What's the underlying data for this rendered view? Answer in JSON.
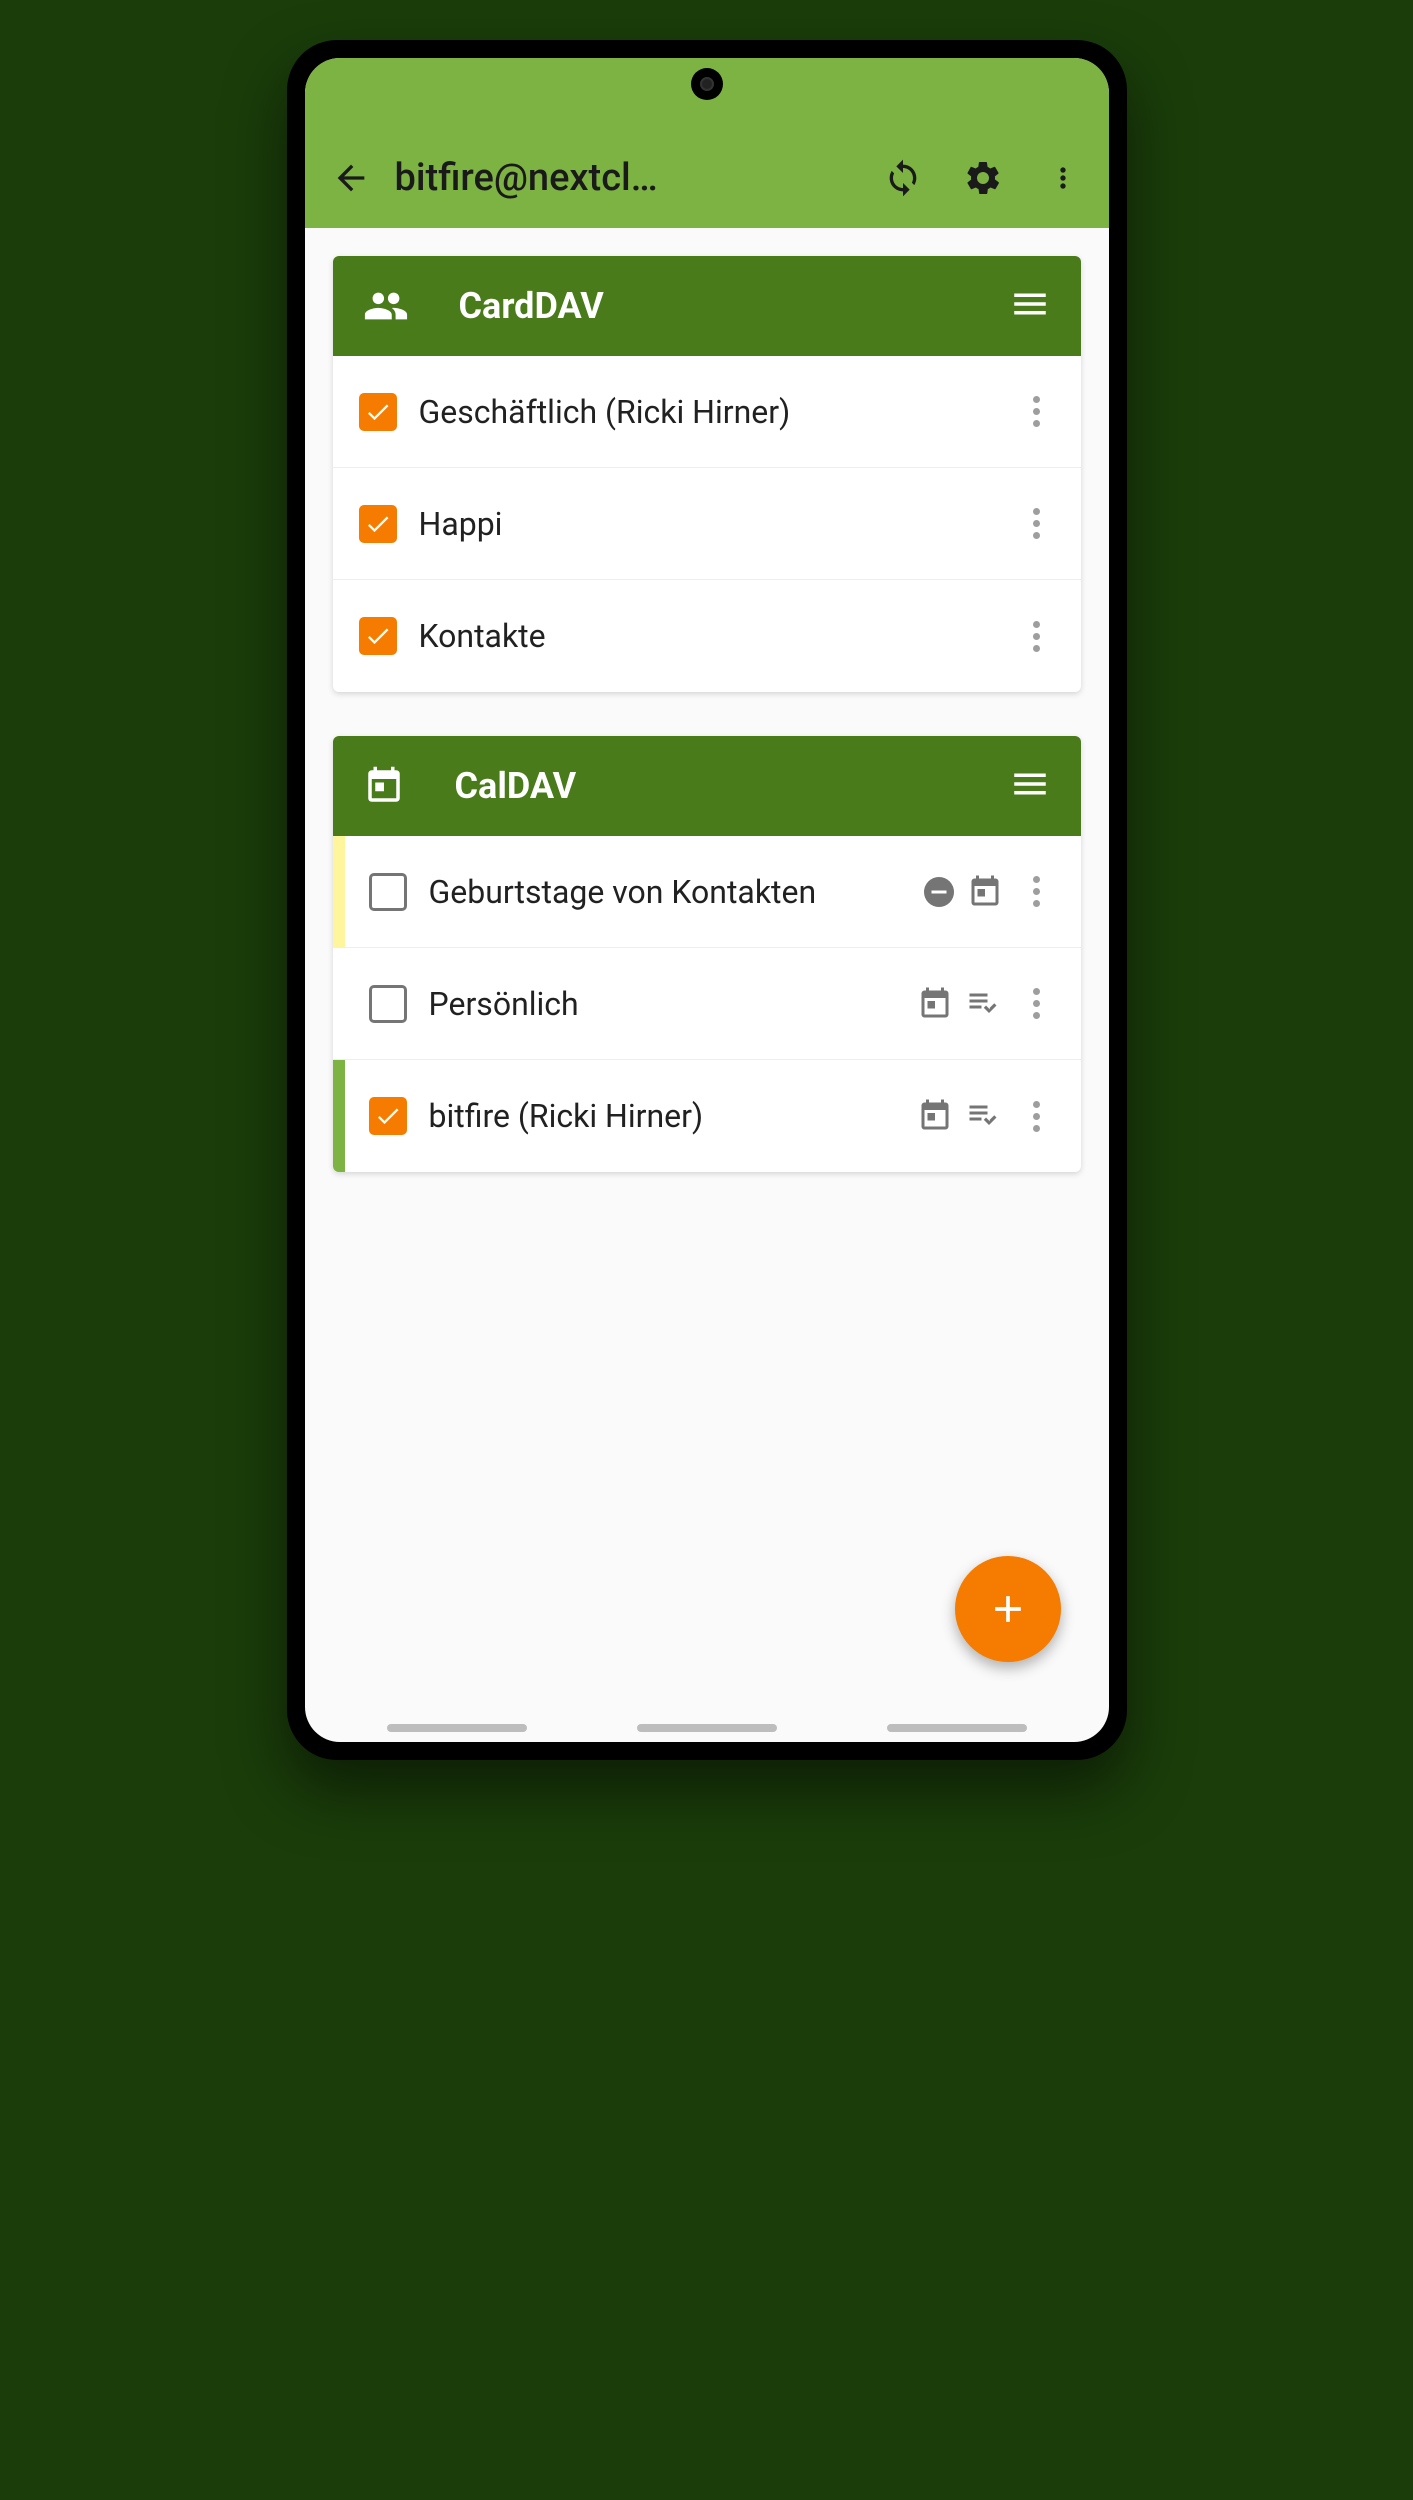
{
  "header": {
    "title": "bitfire@nextcl…"
  },
  "sections": [
    {
      "id": "carddav",
      "title": "CardDAV",
      "icon": "people-icon",
      "items": [
        {
          "label": "Geschäftlich (Ricki Hirner)",
          "checked": true
        },
        {
          "label": "Happi",
          "checked": true
        },
        {
          "label": "Kontakte",
          "checked": true
        }
      ]
    },
    {
      "id": "caldav",
      "title": "CalDAV",
      "icon": "calendar-icon",
      "items": [
        {
          "label": "Geburtstage von Kontakten",
          "checked": false,
          "color": "#fff59d",
          "icons": [
            "readonly",
            "event"
          ]
        },
        {
          "label": "Persönlich",
          "checked": false,
          "color": "",
          "icons": [
            "event",
            "tasks"
          ]
        },
        {
          "label": "bitfire (Ricki Hirner)",
          "checked": true,
          "color": "#7cb342",
          "icons": [
            "event",
            "tasks"
          ]
        }
      ]
    }
  ],
  "colors": {
    "accent": "#f57c00",
    "primary": "#7cb342",
    "primaryDark": "#4a7b1a"
  }
}
